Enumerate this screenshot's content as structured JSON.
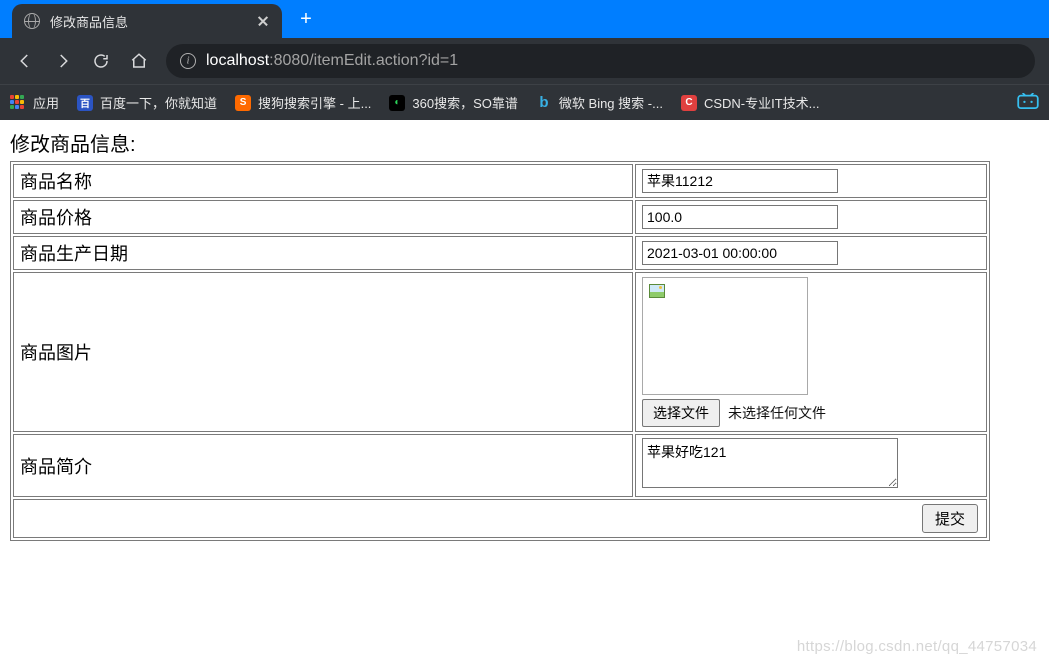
{
  "browser": {
    "tab_title": "修改商品信息",
    "url_host": "localhost",
    "url_port_path": ":8080/itemEdit.action?id=1",
    "bookmarks": [
      {
        "label": "应用",
        "color_grid": [
          "#ea4335",
          "#fbbc05",
          "#34a853",
          "#4285f4",
          "#ea4335",
          "#fbbc05",
          "#34a853",
          "#4285f4",
          "#ea4335"
        ]
      },
      {
        "label": "百度一下，你就知道",
        "bg": "#2b54c3",
        "glyph": "百"
      },
      {
        "label": "搜狗搜索引擎 - 上...",
        "bg": "#ff6a00",
        "glyph": "S"
      },
      {
        "label": "360搜索，SO靠谱",
        "bg": "#000",
        "glyph": "◐",
        "fg": "#2bd45a"
      },
      {
        "label": "微软 Bing 搜索 -...",
        "bg": "transparent",
        "glyph": "b",
        "fg": "#38b1e5"
      },
      {
        "label": "CSDN-专业IT技术...",
        "bg": "#e1403f",
        "glyph": "C"
      }
    ],
    "bilibili_icon_color": "#36bff0"
  },
  "page": {
    "heading": "修改商品信息:",
    "rows": {
      "name": {
        "label": "商品名称",
        "value": "苹果11212"
      },
      "price": {
        "label": "商品价格",
        "value": "100.0"
      },
      "date": {
        "label": "商品生产日期",
        "value": "2021-03-01 00:00:00"
      },
      "image": {
        "label": "商品图片",
        "choose_btn": "选择文件",
        "no_file": "未选择任何文件"
      },
      "desc": {
        "label": "商品简介",
        "value": "苹果好吃121"
      }
    },
    "submit_label": "提交"
  },
  "watermark": "https://blog.csdn.net/qq_44757034"
}
